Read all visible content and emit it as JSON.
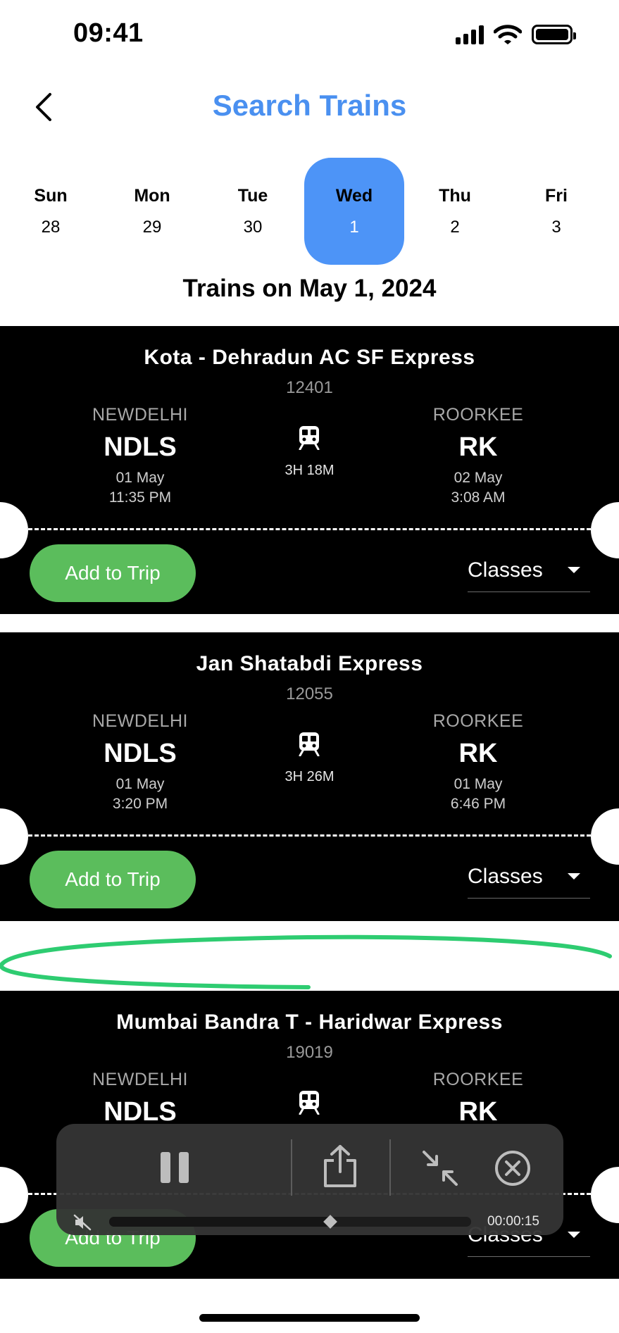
{
  "status_bar": {
    "time": "09:41"
  },
  "header": {
    "title": "Search Trains"
  },
  "days": [
    {
      "name": "Sun",
      "num": "28",
      "selected": false
    },
    {
      "name": "Mon",
      "num": "29",
      "selected": false
    },
    {
      "name": "Tue",
      "num": "30",
      "selected": false
    },
    {
      "name": "Wed",
      "num": "1",
      "selected": true
    },
    {
      "name": "Thu",
      "num": "2",
      "selected": false
    },
    {
      "name": "Fri",
      "num": "3",
      "selected": false
    }
  ],
  "date_heading": "Trains on May 1, 2024",
  "trains": [
    {
      "name": "Kota - Dehradun AC SF Express",
      "number": "12401",
      "from": {
        "city": "NEWDELHI",
        "code": "NDLS",
        "date": "01 May",
        "time": "11:35 PM"
      },
      "to": {
        "city": "ROORKEE",
        "code": "RK",
        "date": "02 May",
        "time": "3:08 AM"
      },
      "duration": "3H 18M",
      "add_label": "Add to Trip",
      "classes_label": "Classes"
    },
    {
      "name": "Jan Shatabdi Express",
      "number": "12055",
      "from": {
        "city": "NEWDELHI",
        "code": "NDLS",
        "date": "01 May",
        "time": "3:20 PM"
      },
      "to": {
        "city": "ROORKEE",
        "code": "RK",
        "date": "01 May",
        "time": "6:46 PM"
      },
      "duration": "3H 26M",
      "add_label": "Add to Trip",
      "classes_label": "Classes"
    },
    {
      "name": "Mumbai Bandra T - Haridwar Express",
      "number": "19019",
      "from": {
        "city": "NEWDELHI",
        "code": "NDLS",
        "date": "",
        "time": ""
      },
      "to": {
        "city": "ROORKEE",
        "code": "RK",
        "date": "",
        "time": ""
      },
      "duration": "",
      "add_label": "Add to Trip",
      "classes_label": "Classes"
    }
  ],
  "player": {
    "elapsed": "00:00:15",
    "progress": 0.61
  },
  "colors": {
    "accent": "#4d94f7",
    "title": "#4a90f0",
    "add_button": "#5bbd5c",
    "scribble": "#2ecc71"
  }
}
